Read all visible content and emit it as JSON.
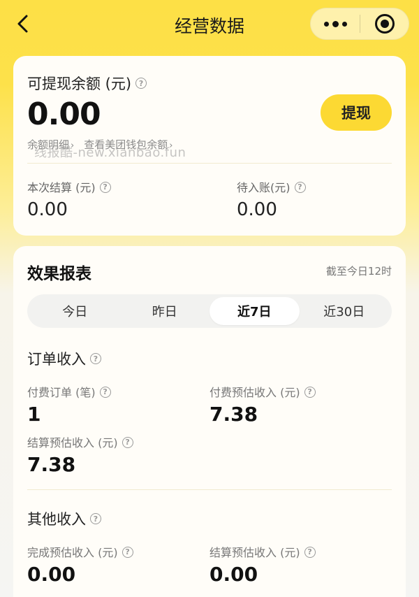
{
  "nav": {
    "title": "经营数据",
    "back_icon": "chevron-left-icon",
    "more_icon": "more-dots-icon",
    "close_icon": "target-icon"
  },
  "balance": {
    "label": "可提现余额 (元)",
    "value": "0.00",
    "withdraw_label": "提现",
    "link_detail": "余额明细",
    "link_wallet": "查看美团钱包余额",
    "link_chevron": "›",
    "watermark": "线报酷-new.xianbao.fun",
    "settlement_label": "本次结算 (元)",
    "settlement_value": "0.00",
    "pending_label": "待入账(元)",
    "pending_value": "0.00"
  },
  "report": {
    "title": "效果报表",
    "note": "截至今日12时",
    "tabs": [
      {
        "label": "今日",
        "active": false
      },
      {
        "label": "昨日",
        "active": false
      },
      {
        "label": "近7日",
        "active": true
      },
      {
        "label": "近30日",
        "active": false
      }
    ],
    "order_section": {
      "title": "订单收入",
      "paid_orders_label": "付费订单 (笔)",
      "paid_orders_value": "1",
      "paid_est_label": "付费预估收入 (元)",
      "paid_est_value": "7.38",
      "settle_est_label": "结算预估收入 (元)",
      "settle_est_value": "7.38"
    },
    "other_section": {
      "title": "其他收入",
      "complete_est_label": "完成预估收入 (元)",
      "complete_est_value": "0.00",
      "settle_est_label": "结算预估收入 (元)",
      "settle_est_value": "0.00"
    }
  },
  "colors": {
    "accent": "#fcd933",
    "header_bg": "#fde046",
    "card_bg": "#fffdf8"
  }
}
